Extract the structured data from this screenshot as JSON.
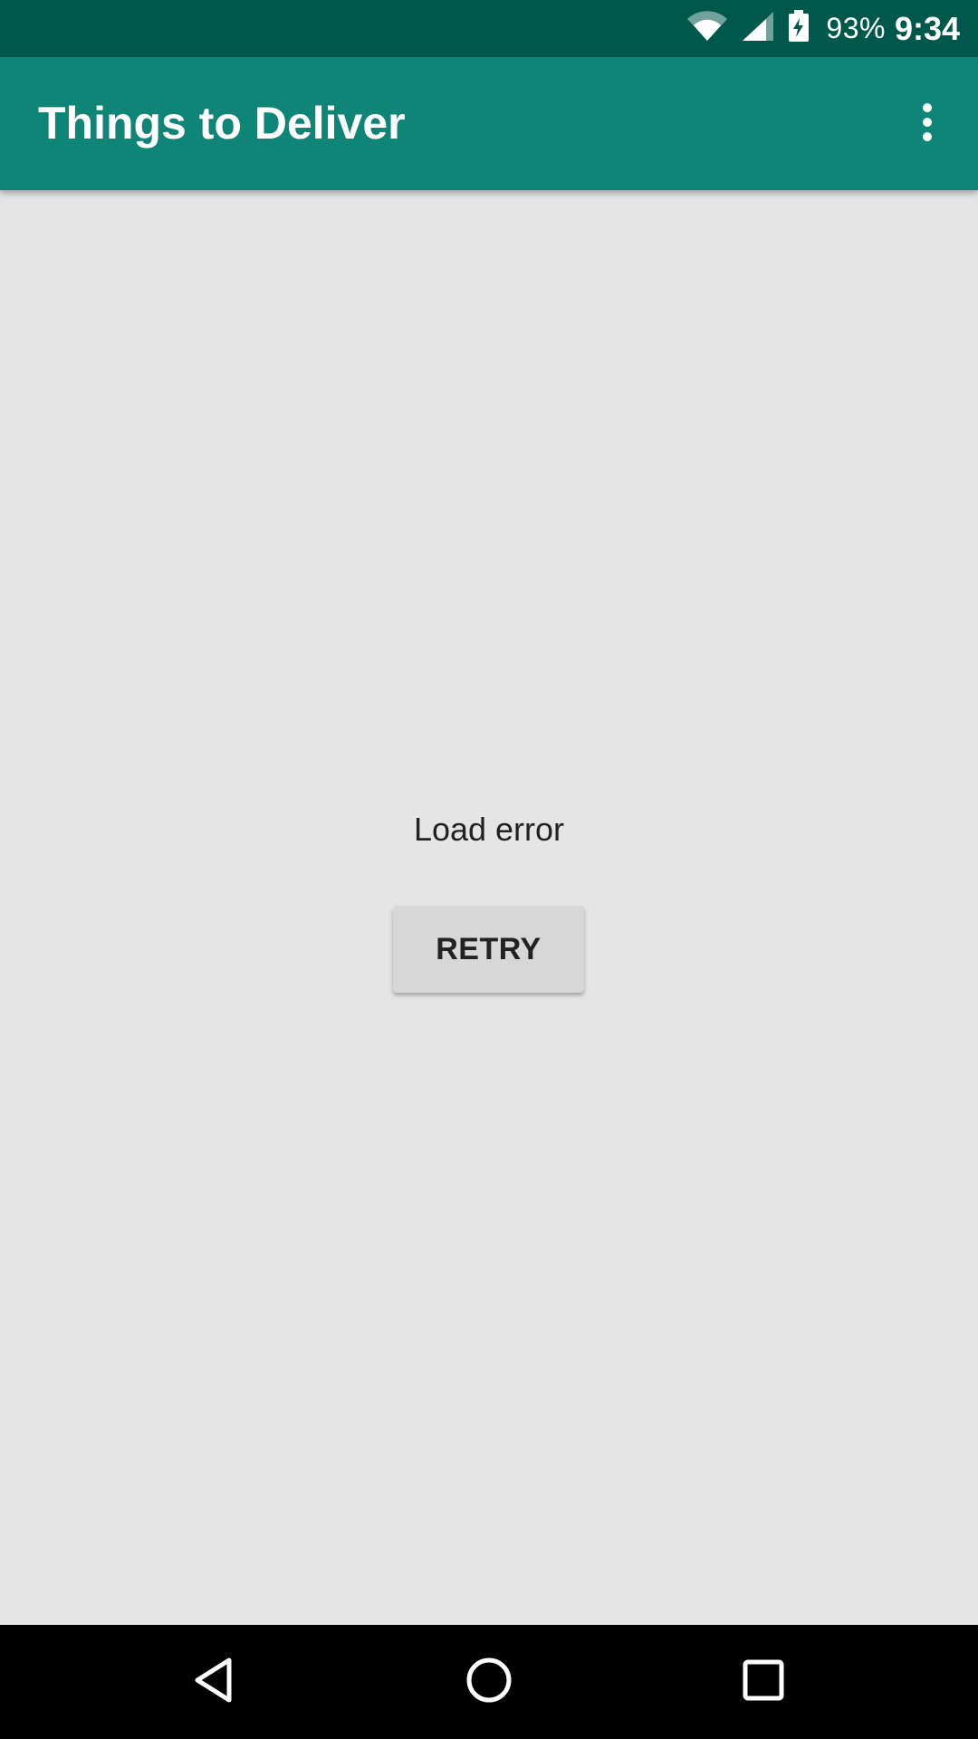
{
  "status_bar": {
    "battery_percent": "93%",
    "time": "9:34",
    "icons": [
      "wifi-icon",
      "cell-signal-icon",
      "battery-charging-icon"
    ]
  },
  "app_bar": {
    "title": "Things to Deliver",
    "overflow_icon": "more-vert-icon"
  },
  "main": {
    "error_message": "Load error",
    "retry_label": "RETRY"
  },
  "nav_bar": {
    "buttons": [
      "back-icon",
      "home-icon",
      "recents-icon"
    ]
  },
  "colors": {
    "status_bar": "#00574b",
    "app_bar": "#0e8576",
    "background": "#e5e5e5",
    "button": "#d7d7d7"
  }
}
